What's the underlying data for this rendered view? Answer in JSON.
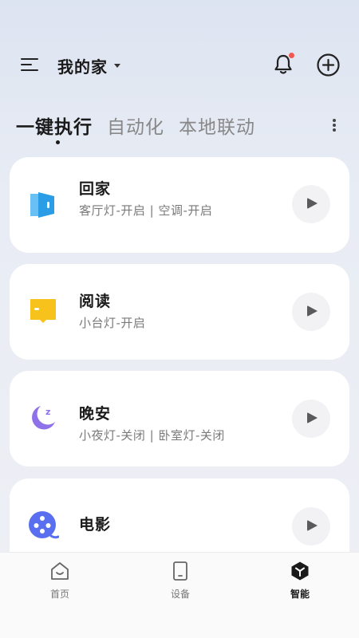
{
  "header": {
    "home_name": "我的家",
    "has_notification": true
  },
  "tabs": [
    {
      "label": "一键执行",
      "active": true
    },
    {
      "label": "自动化",
      "active": false
    },
    {
      "label": "本地联动",
      "active": false
    }
  ],
  "scenes": [
    {
      "title": "回家",
      "subtitle": "客厅灯-开启 | 空调-开启",
      "icon": "door-icon",
      "color": "#2a9de6"
    },
    {
      "title": "阅读",
      "subtitle": "小台灯-开启",
      "icon": "book-icon",
      "color": "#f8c21c"
    },
    {
      "title": "晚安",
      "subtitle": "小夜灯-关闭 | 卧室灯-关闭",
      "icon": "moon-icon",
      "color": "#8f72ea"
    },
    {
      "title": "电影",
      "subtitle": "",
      "icon": "film-reel-icon",
      "color": "#5a6ff0"
    }
  ],
  "bottom_nav": [
    {
      "label": "首页",
      "icon": "home-icon",
      "active": false
    },
    {
      "label": "设备",
      "icon": "device-icon",
      "active": false
    },
    {
      "label": "智能",
      "icon": "smart-icon",
      "active": true
    }
  ]
}
